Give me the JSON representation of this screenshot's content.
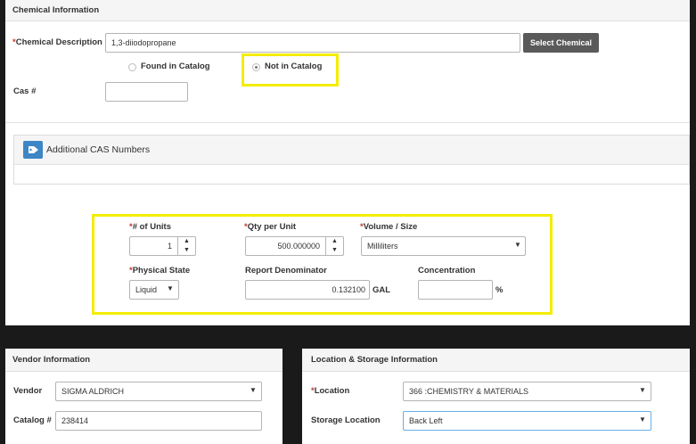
{
  "chemical_info": {
    "header": "Chemical Information",
    "description_label": "Chemical Description",
    "description_value": "1,3-diiodopropane",
    "select_button": "Select Chemical",
    "radio_found": "Found in Catalog",
    "radio_not_found": "Not in Catalog",
    "selected_radio": "Not in Catalog",
    "cas_label": "Cas #",
    "cas_value": ""
  },
  "additional_cas": {
    "title": "Additional CAS Numbers",
    "icon": "tag-icon"
  },
  "quantity": {
    "units_label": "# of Units",
    "units_value": "1",
    "qty_label": "Qty per Unit",
    "qty_value": "500.000000",
    "volume_label": "Volume / Size",
    "volume_value": "Milliliters",
    "state_label": "Physical State",
    "state_value": "Liquid",
    "denominator_label": "Report Denominator",
    "denominator_value": "0.132100",
    "denominator_unit": "GAL",
    "concentration_label": "Concentration",
    "concentration_value": "",
    "concentration_unit": "%"
  },
  "vendor": {
    "header": "Vendor Information",
    "vendor_label": "Vendor",
    "vendor_value": "SIGMA ALDRICH",
    "catalog_label": "Catalog #",
    "catalog_value": "238414"
  },
  "location": {
    "header": "Location & Storage Information",
    "location_label": "Location",
    "location_value": "366 :CHEMISTRY & MATERIALS",
    "storage_label": "Storage Location",
    "storage_value": "Back Left"
  },
  "colors": {
    "highlight": "#f4ec00",
    "required": "#c0392b",
    "button": "#5a5a5a",
    "tag_icon": "#3d86c6",
    "focus_border": "#66afe9"
  }
}
